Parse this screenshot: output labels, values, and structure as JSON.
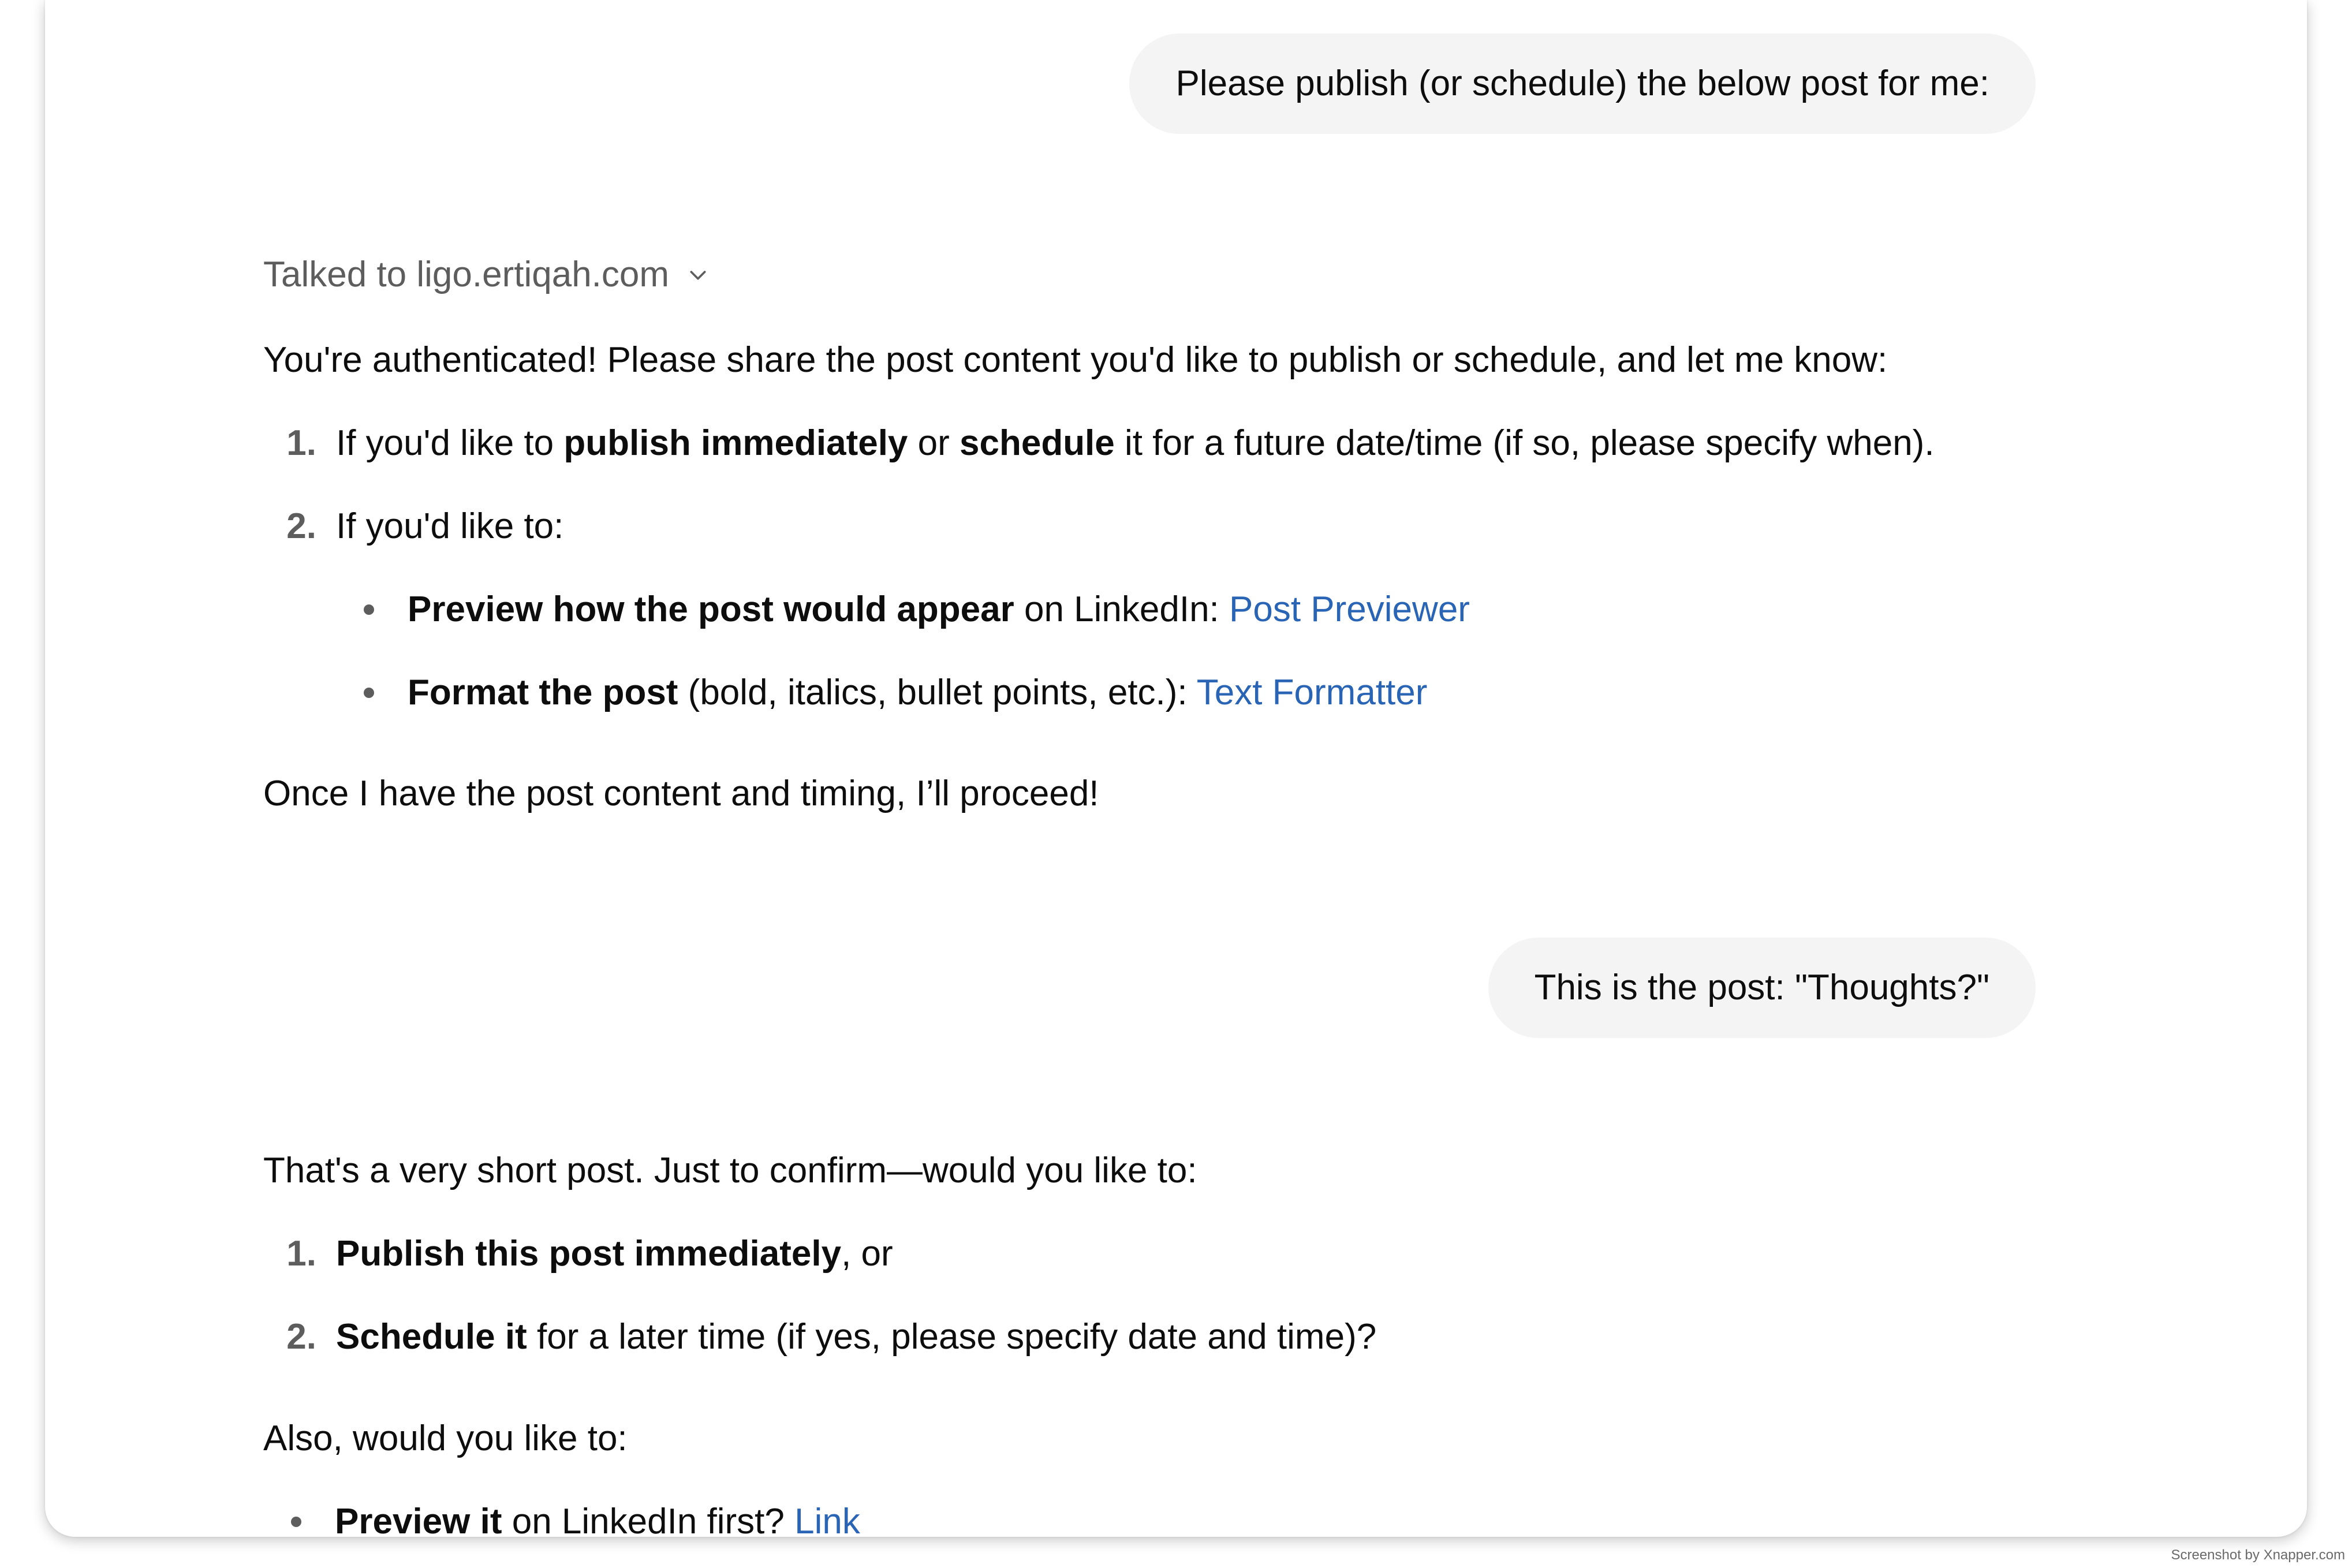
{
  "messages": {
    "user_1": "Please publish (or schedule) the below post for me:",
    "user_2": "This is the post: \"Thoughts?\""
  },
  "tool_call": {
    "label": "Talked to ligo.ertiqah.com",
    "icon": "chevron-down-icon"
  },
  "reply_1": {
    "intro": "You're authenticated! Please share the post content you'd like to publish or schedule, and let me know:",
    "items": [
      {
        "number": "1.",
        "pre": "If you'd like to ",
        "bold_a": "publish immediately",
        "mid": " or ",
        "bold_b": "schedule",
        "post": " it for a future date/time (if so, please specify when)."
      },
      {
        "number": "2.",
        "text": "If you'd like to:"
      }
    ],
    "subitems": [
      {
        "bold": "Preview how the post would appear",
        "text": " on LinkedIn: ",
        "link": "Post Previewer"
      },
      {
        "bold": "Format the post",
        "text": " (bold, italics, bullet points, etc.): ",
        "link": "Text Formatter"
      }
    ],
    "closing": "Once I have the post content and timing, I’ll proceed!"
  },
  "reply_2": {
    "intro": "That's a very short post. Just to confirm—would you like to:",
    "items": [
      {
        "number": "1.",
        "bold": "Publish this post immediately",
        "text": ", or"
      },
      {
        "number": "2.",
        "bold": "Schedule it",
        "text": " for a later time (if yes, please specify date and time)?"
      }
    ],
    "also": "Also, would you like to:",
    "bullet": {
      "bold": "Preview it",
      "text": " on LinkedIn first? ",
      "link": "Link"
    }
  },
  "watermark": "Screenshot by Xnapper.com",
  "colors": {
    "link": "#2a64b4",
    "bubble": "#f4f4f4",
    "muted": "#5d5d5d",
    "text": "#0d0d0d"
  }
}
